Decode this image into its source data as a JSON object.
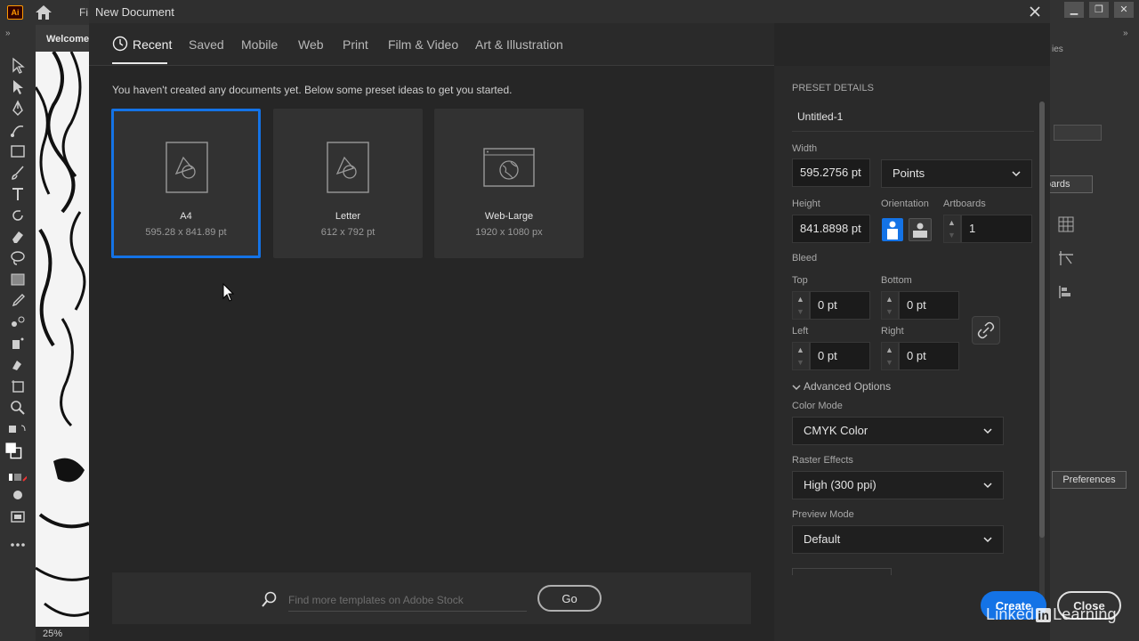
{
  "app": {
    "logo": "Ai",
    "file_tab_fragment": "Fi",
    "welcome_tab": "Welcome",
    "zoom": "25%",
    "libraries_tab_fragment": "ies",
    "artboards_button_fragment": "oards",
    "preferences_button": "Preferences",
    "toolbar_collapse": "»",
    "panel_collapse": "»"
  },
  "dialog": {
    "title": "New Document",
    "tabs": [
      {
        "label": "Recent",
        "active": true
      },
      {
        "label": "Saved"
      },
      {
        "label": "Mobile"
      },
      {
        "label": "Web"
      },
      {
        "label": "Print"
      },
      {
        "label": "Film & Video"
      },
      {
        "label": "Art & Illustration"
      }
    ],
    "intro": "You haven't created any documents yet. Below some preset ideas to get you started.",
    "presets": [
      {
        "name": "A4",
        "size": "595.28 x 841.89 pt",
        "icon": "document-shapes-icon",
        "selected": true
      },
      {
        "name": "Letter",
        "size": "612 x 792 pt",
        "icon": "document-shapes-icon"
      },
      {
        "name": "Web-Large",
        "size": "1920 x 1080 px",
        "icon": "browser-globe-icon"
      }
    ],
    "search": {
      "placeholder": "Find more templates on Adobe Stock",
      "go_label": "Go"
    },
    "details": {
      "section_title": "PRESET DETAILS",
      "name": "Untitled-1",
      "width_label": "Width",
      "width": "595.2756 pt",
      "units": "Points",
      "height_label": "Height",
      "height": "841.8898 pt",
      "orientation_label": "Orientation",
      "artboards_label": "Artboards",
      "artboards": "1",
      "bleed_label": "Bleed",
      "top_label": "Top",
      "top": "0 pt",
      "bottom_label": "Bottom",
      "bottom": "0 pt",
      "left_label": "Left",
      "left": "0 pt",
      "right_label": "Right",
      "right": "0 pt",
      "advanced_label": "Advanced Options",
      "color_mode_label": "Color Mode",
      "color_mode": "CMYK Color",
      "raster_label": "Raster Effects",
      "raster": "High (300 ppi)",
      "preview_label": "Preview Mode",
      "preview": "Default"
    },
    "buttons": {
      "create": "Create",
      "close": "Close"
    }
  },
  "watermark": {
    "linked": "Linked",
    "in": "in",
    "learning": "Learning"
  },
  "colors": {
    "accent": "#1473e6",
    "dialog_bg": "#262626",
    "panel_bg": "#2a2a2a"
  }
}
